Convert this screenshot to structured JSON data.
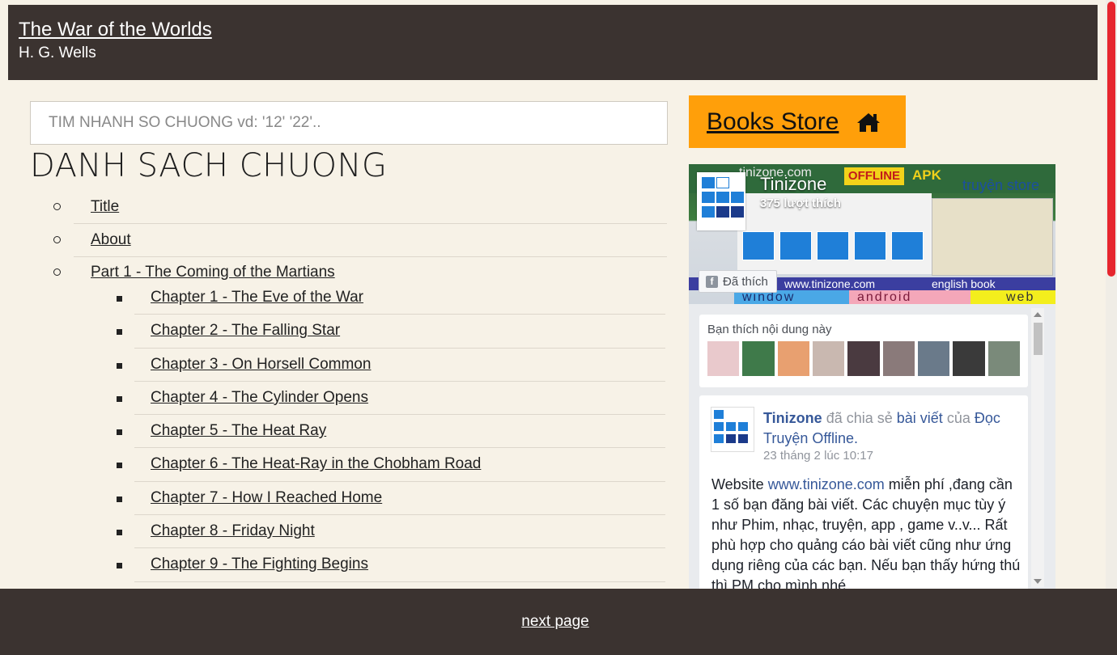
{
  "header": {
    "title": "The War of the Worlds",
    "author": "H. G. Wells"
  },
  "search": {
    "placeholder": "TIM NHANH SO CHUONG vd: '12' '22'.."
  },
  "toc": {
    "heading": "DANH SACH CHUONG",
    "top_items": [
      "Title",
      "About"
    ],
    "part": "Part 1 - The Coming of the Martians",
    "chapters": [
      "Chapter 1 - The Eve of the War",
      "Chapter 2 - The Falling Star",
      "Chapter 3 - On Horsell Common",
      "Chapter 4 - The Cylinder Opens",
      "Chapter 5 - The Heat Ray",
      "Chapter 6 - The Heat-Ray in the Chobham Road",
      "Chapter 7 - How I Reached Home",
      "Chapter 8 - Friday Night",
      "Chapter 9 - The Fighting Begins"
    ]
  },
  "store": {
    "label": "Books Store",
    "icon": "home-icon",
    "color": "#ff9f0a"
  },
  "facebook": {
    "cover": {
      "site": "tinizone.com",
      "offline": "OFFLINE",
      "apk": "APK",
      "store_text": "truyện store",
      "strip_site": "www.tinizone.com",
      "strip_book": "english book",
      "strip_window": "window",
      "strip_android": "android",
      "strip_web": "web"
    },
    "page_name": "Tinizone",
    "likes": "375 lượt thích",
    "liked_button": "Đã thích",
    "fans_label": "Bạn thích nội dung này",
    "post": {
      "page": "Tinizone",
      "shared_text": "đã chia sẻ",
      "shared_link": "bài viết",
      "of_text": "của",
      "source": "Đọc Truyện Offline.",
      "time": "23 tháng 2 lúc 10:17",
      "body_start": "Website",
      "body_link": "www.tinizone.com",
      "body_rest": "miễn phí ,đang cần 1 số bạn đăng bài viết. Các chuyện mục tùy ý như Phim, nhạc, truyện, app , game v..v... Rất phù hợp cho quảng cáo bài viết cũng như ứng dụng riêng của các bạn. Nếu bạn thấy hứng thú thì PM cho mình nhé"
    }
  },
  "footer": {
    "next": "next page"
  },
  "colors": {
    "header_bg": "#3b3330",
    "page_bg": "#f7f2e7",
    "scroll_thumb": "#e6262e",
    "fb_link": "#365899"
  }
}
